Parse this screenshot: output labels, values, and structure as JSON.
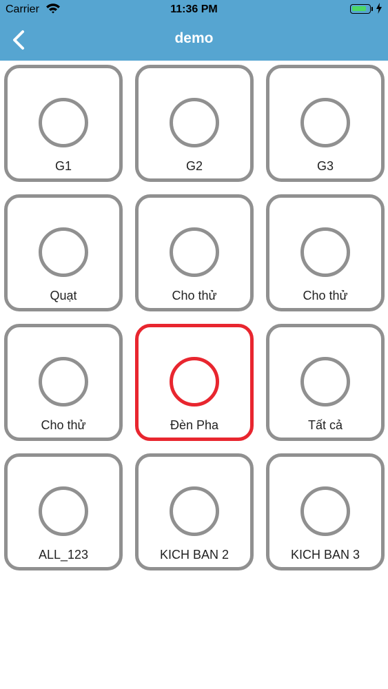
{
  "status_bar": {
    "carrier": "Carrier",
    "time": "11:36 PM",
    "battery_level_percent": 85
  },
  "header": {
    "title": "demo",
    "back_icon": "chevron-left-icon"
  },
  "colors": {
    "header_bg": "#56a5d1",
    "tile_border": "#909090",
    "active": "#e8262f"
  },
  "tiles": [
    {
      "label": "G1",
      "active": false
    },
    {
      "label": "G2",
      "active": false
    },
    {
      "label": "G3",
      "active": false
    },
    {
      "label": "Quạt",
      "active": false
    },
    {
      "label": "Cho thử",
      "active": false
    },
    {
      "label": "Cho thử",
      "active": false
    },
    {
      "label": "Cho thử",
      "active": false
    },
    {
      "label": "Đèn Pha",
      "active": true
    },
    {
      "label": "Tất cả",
      "active": false
    },
    {
      "label": "ALL_123",
      "active": false
    },
    {
      "label": "KICH BAN 2",
      "active": false
    },
    {
      "label": "KICH BAN 3",
      "active": false
    }
  ]
}
